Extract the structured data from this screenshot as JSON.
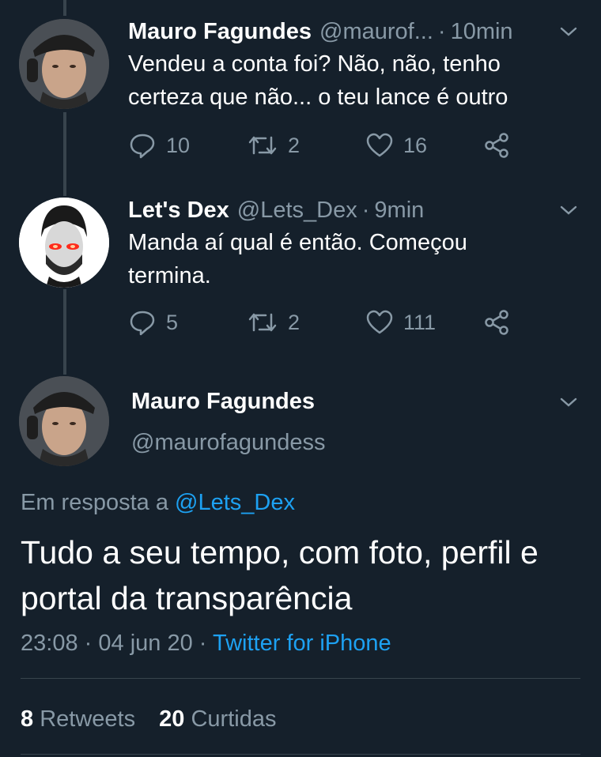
{
  "thread": [
    {
      "name": "Mauro Fagundes",
      "handle": "@maurof...",
      "time": "10min",
      "text": "Vendeu a conta foi? Não, não, tenho certeza que não... o teu lance é outro",
      "replies": "10",
      "retweets": "2",
      "likes": "16"
    },
    {
      "name": "Let's Dex",
      "handle": "@Lets_Dex",
      "time": "9min",
      "text": "Manda aí qual é então. Começou termina.",
      "replies": "5",
      "retweets": "2",
      "likes": "111"
    }
  ],
  "main": {
    "name": "Mauro Fagundes",
    "handle": "@maurofagundess",
    "reply_prefix": "Em resposta a",
    "reply_to": "@Lets_Dex",
    "text": "Tudo a seu tempo, com foto, perfil e portal da transparência",
    "time": "23:08",
    "date": "04 jun 20",
    "source": "Twitter for iPhone",
    "retweet_count": "8",
    "retweet_label": "Retweets",
    "like_count": "20",
    "like_label": "Curtidas"
  },
  "separator": "·",
  "colors": {
    "background": "#15202b",
    "muted": "#8899a6",
    "accent": "#1da1f2",
    "divider": "#38444d"
  },
  "icons": [
    "reply-icon",
    "retweet-icon",
    "like-icon",
    "share-icon",
    "chevron-down-icon"
  ]
}
